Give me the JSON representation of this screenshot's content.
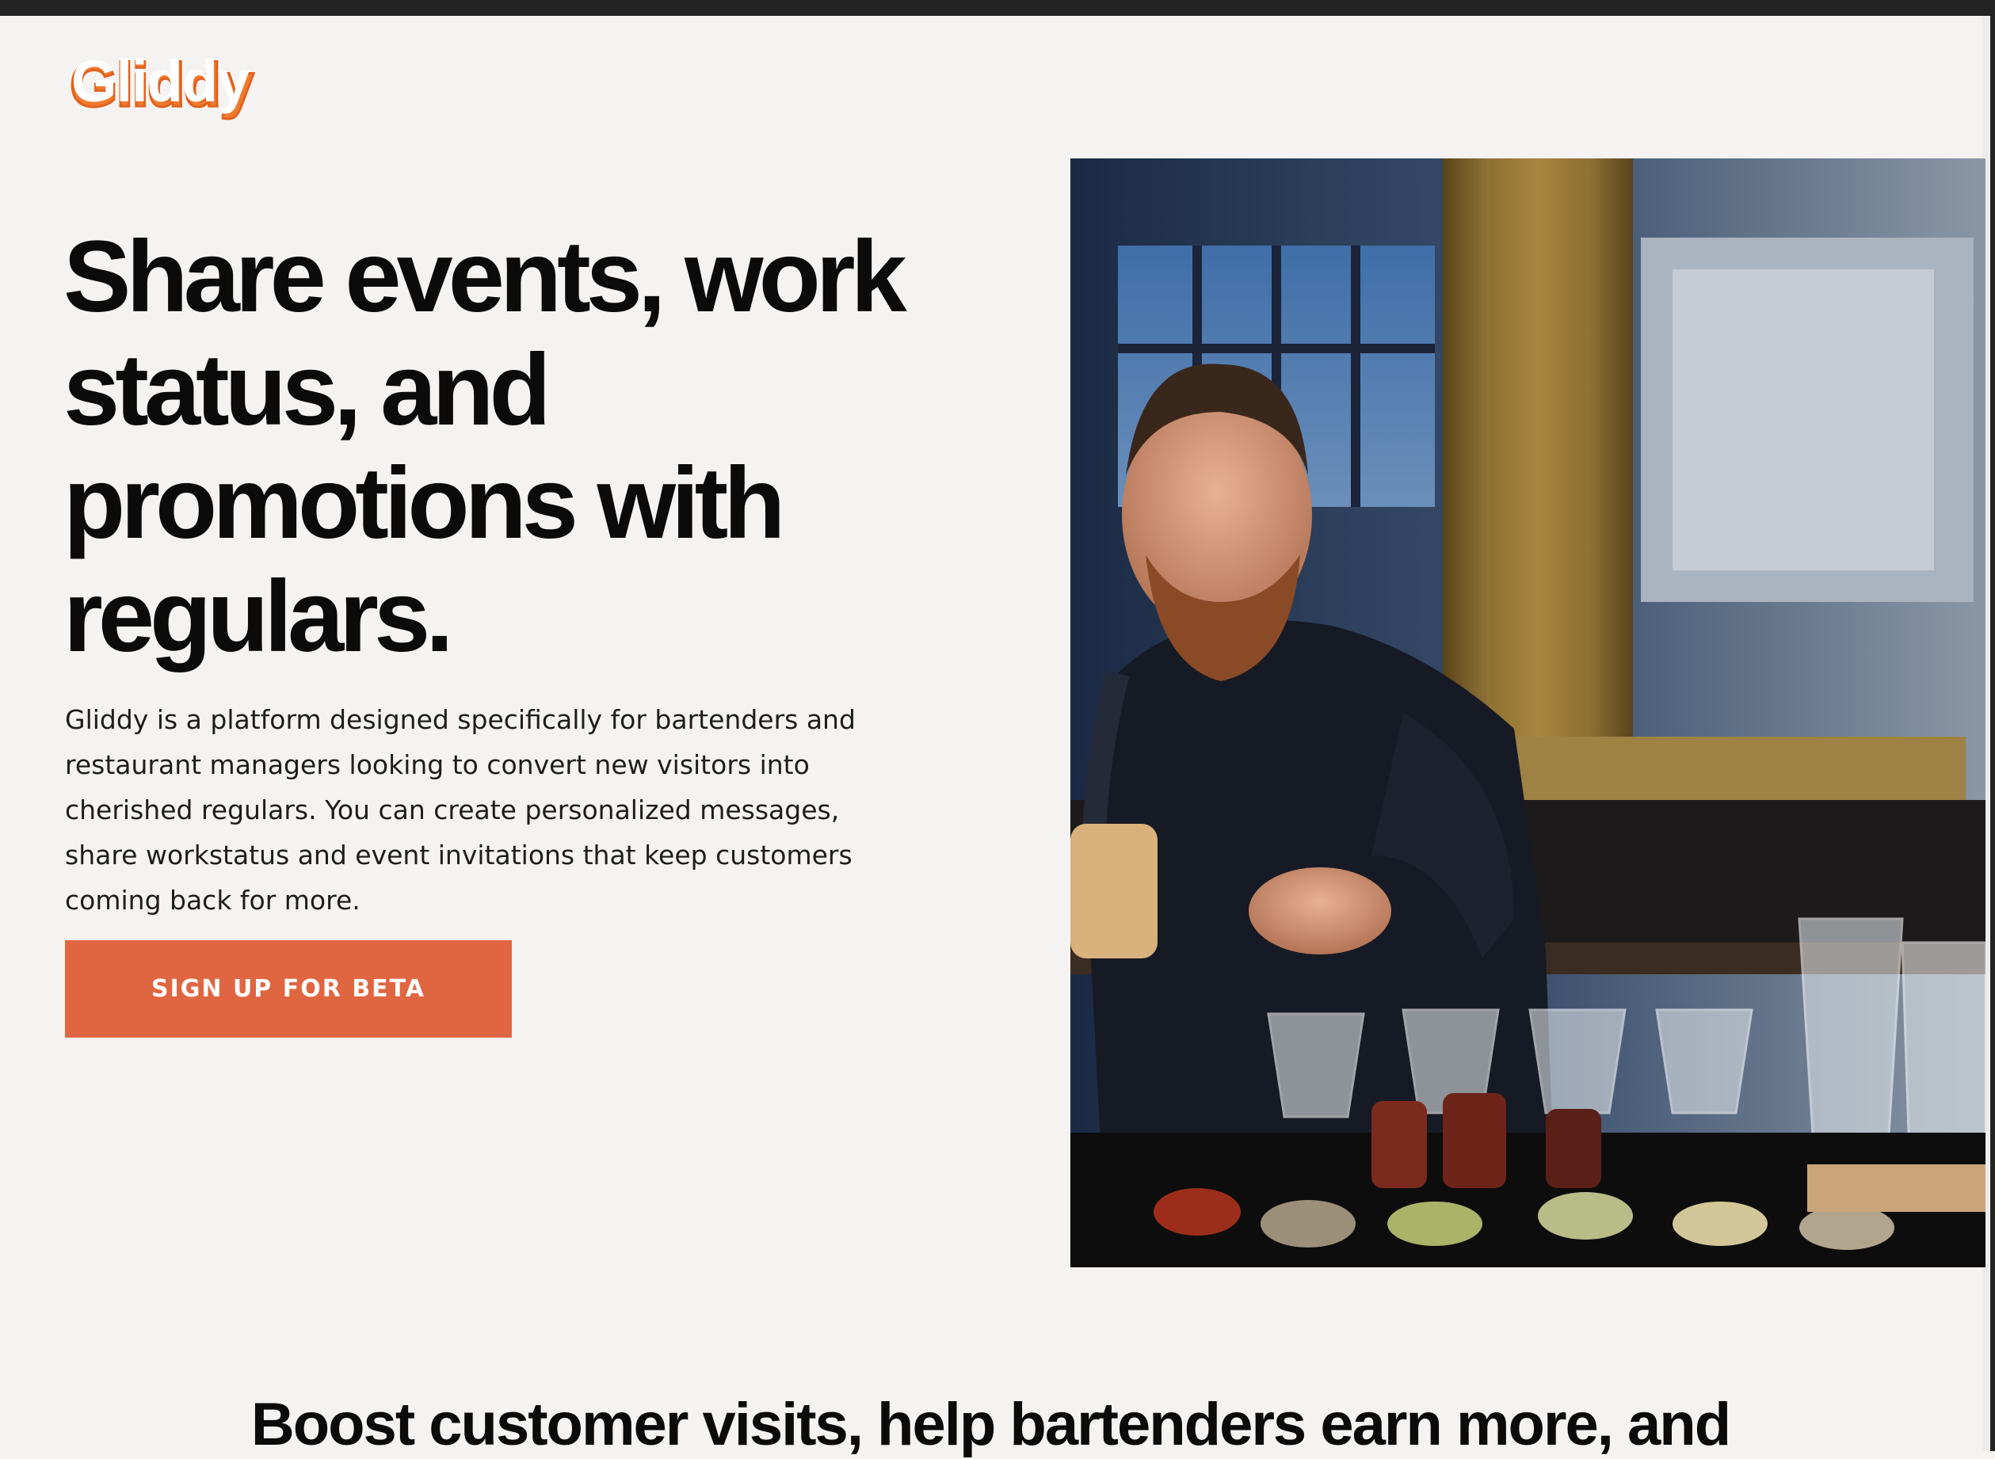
{
  "brand": {
    "logo_text": "Gliddy",
    "accent": "#e06641",
    "logo_color": "#f07a2e"
  },
  "hero": {
    "title": "Share events, work status, and promotions with regulars.",
    "description": "Gliddy is a platform designed specifically for bartenders and restaurant managers looking to convert new visitors into cherished regulars. You can create personalized messages, share workstatus and event invitations that keep customers coming back for more.",
    "cta_label": "SIGN UP FOR BETA"
  },
  "section": {
    "title": "Boost customer visits, help bartenders earn more, and"
  }
}
